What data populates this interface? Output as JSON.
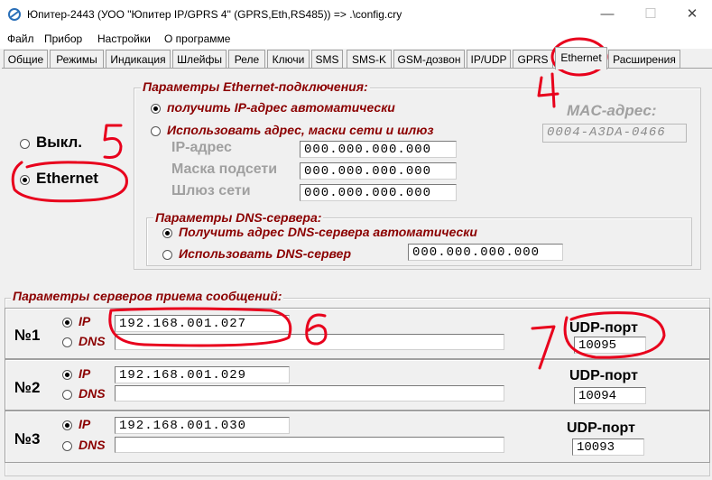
{
  "window": {
    "title": "Юпитер-2443 (УОО \"Юпитер IP/GPRS 4\" (GPRS,Eth,RS485))   =>   .\\config.cry",
    "minimize": "—",
    "maximize": "☐",
    "close": "✕"
  },
  "menu": [
    "Файл",
    "Прибор",
    "Настройки",
    "О программе"
  ],
  "tabs": [
    "Общие",
    "Режимы",
    "Индикация",
    "Шлейфы",
    "Реле",
    "Ключи",
    "SMS",
    "SMS-K",
    "GSM-дозвон",
    "IP/UDP",
    "GPRS",
    "Ethernet",
    "Расширения"
  ],
  "active_tab": "Ethernet",
  "mode": {
    "off_label": "Выкл.",
    "ethernet_label": "Ethernet",
    "selected": "Ethernet"
  },
  "eth_params": {
    "title": "Параметры Ethernet-подключения:",
    "auto_ip_label": "получить IP-адрес автоматически",
    "manual_label": "Использовать адрес, маски сети и шлюз",
    "ip_label": "IP-адрес",
    "mask_label": "Маска подсети",
    "gateway_label": "Шлюз сети",
    "ip_value": "000.000.000.000",
    "mask_value": "000.000.000.000",
    "gateway_value": "000.000.000.000",
    "selected": "auto"
  },
  "mac": {
    "label": "MAC-адрес:",
    "value": "0004-A3DA-0466"
  },
  "dns": {
    "title": "Параметры DNS-сервера:",
    "auto_label": "Получить адрес DNS-сервера автоматически",
    "manual_label": "Использовать DNS-сервер",
    "value": "000.000.000.000",
    "selected": "auto"
  },
  "servers": {
    "title": "Параметры серверов приема сообщений:",
    "ip_option": "IP",
    "dns_option": "DNS",
    "udp_label": "UDP-порт",
    "rows": [
      {
        "label": "№1",
        "ip": "192.168.001.027",
        "dns": "",
        "port": "10095"
      },
      {
        "label": "№2",
        "ip": "192.168.001.029",
        "dns": "",
        "port": "10094"
      },
      {
        "label": "№3",
        "ip": "192.168.001.030",
        "dns": "",
        "port": "10093"
      }
    ]
  },
  "annotations": {
    "color": "#e8001c",
    "numbers": [
      "4",
      "5",
      "6",
      "7"
    ]
  }
}
